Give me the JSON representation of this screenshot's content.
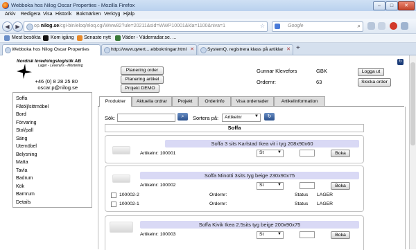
{
  "window": {
    "title": "Webboka hos Nilog Oscar Properties - Mozilla Firefox",
    "min": "–",
    "max": "□",
    "close": "✕"
  },
  "menu": [
    "Arkiv",
    "Redigera",
    "Visa",
    "Historik",
    "Bokmärken",
    "Verktyg",
    "Hjälp"
  ],
  "nav": {
    "url_prefix": "op.",
    "url_domain": "nilog.se",
    "url_rest": "/cgi-bin/eloq/eloq.cgi/Www82?ule=20211&sid=WWP10001&kla=1100&niva=1",
    "search_placeholder": "Google"
  },
  "bookmarks": [
    "Mest besökta",
    "Kom igång",
    "Senaste nytt",
    "Väder - Väderradar.se. ..."
  ],
  "tabs": [
    {
      "label": "Webboka hos Nilog Oscar Properties",
      "active": true
    },
    {
      "label": "http://www.qwert....ebbokningar.html",
      "active": false
    },
    {
      "label": "SystemQ, registrera klass på artiklar i ...",
      "active": false
    }
  ],
  "new_tab": "+",
  "company": {
    "name": "Nordisk Inredningslogistik AB",
    "tagline": "Lager - Leverans - Montering",
    "phone": "+46 (0) 8 28 25 80",
    "email": "oscar.p@nilog.se"
  },
  "planning_buttons": [
    "Planering order",
    "Planering artikel",
    "Projekt DEMO"
  ],
  "user": {
    "name": "Gunnar Klevefors",
    "code": "GBK",
    "order_label": "Ordernr:",
    "order_no": "63"
  },
  "actions": {
    "logout": "Logga ut",
    "send_order": "Skicka order"
  },
  "categories": [
    "Soffa",
    "Fåtölj/sittmöbel",
    "Bord",
    "Förvaring",
    "Stol/pall",
    "Säng",
    "Utemöbel",
    "Belysning",
    "Matta",
    "Tavla",
    "Badrum",
    "Kök",
    "Barnrum",
    "Details"
  ],
  "content_tabs": [
    {
      "label": "Produkter",
      "active": true
    },
    {
      "label": "Aktuella ordrar",
      "active": false
    },
    {
      "label": "Projekt",
      "active": false
    },
    {
      "label": "Orderinfo",
      "active": false
    },
    {
      "label": "Visa orderrader",
      "active": false
    },
    {
      "label": "Artikelinformation",
      "active": false
    }
  ],
  "search": {
    "label": "Sök:",
    "value": "",
    "sort_label": "Sortera på:",
    "sort_value": "Artikelnr"
  },
  "section_title": "Soffa",
  "products": [
    {
      "title": "Soffa 3 sits Karlstad Ikea vit i tyg 208x90x60",
      "art_label": "Artikelnr:",
      "art_no": "100001",
      "unit": "St",
      "book": "Boka",
      "items": []
    },
    {
      "title": "Soffa Minotti 3sits tyg beige 230x90x75",
      "art_label": "Artikelnr:",
      "art_no": "100002",
      "unit": "St",
      "book": "Boka",
      "items": [
        {
          "id": "100002-2",
          "order_label": "Ordernr:",
          "order": "",
          "status_label": "Status",
          "status": "LAGER"
        },
        {
          "id": "100002-1",
          "order_label": "Ordernr:",
          "order": "",
          "status_label": "Status",
          "status": "LAGER"
        }
      ]
    },
    {
      "title": "Soffa Kivik Ikea 2.5sits tyg beige 200x90x75",
      "art_label": "Artikelnr:",
      "art_no": "100003",
      "unit": "St",
      "book": "Boka",
      "items": []
    }
  ]
}
